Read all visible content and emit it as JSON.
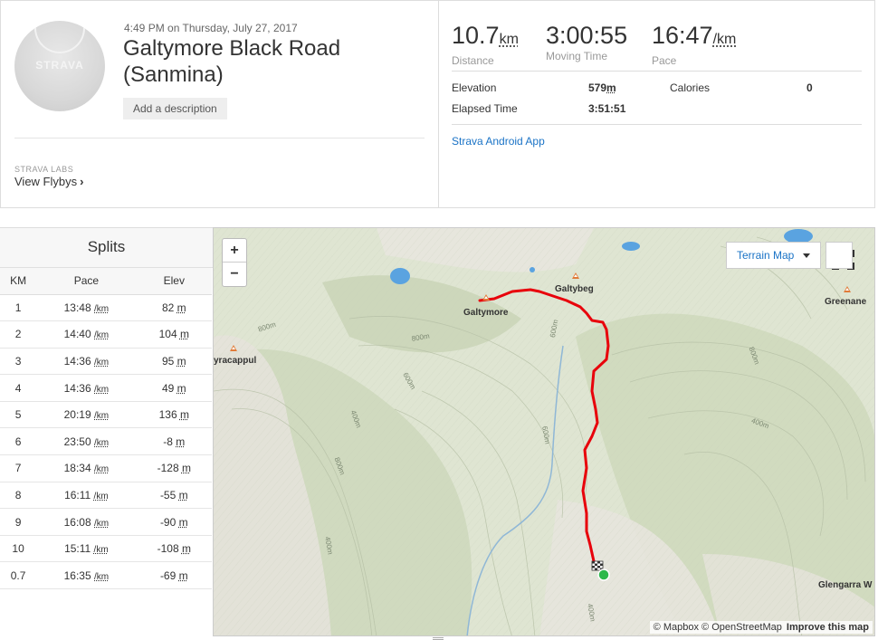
{
  "activity": {
    "datetime": "4:49 PM on Thursday, July 27, 2017",
    "title": "Galtymore Black Road (Sanmina)",
    "add_description": "Add a description",
    "avatar_logo": "STRAVA",
    "labs_tag": "STRAVA LABS",
    "flybys": "View Flybys"
  },
  "stats": {
    "distance": {
      "value": "10.7",
      "unit": "km",
      "label": "Distance"
    },
    "moving_time": {
      "value": "3:00:55",
      "label": "Moving Time"
    },
    "pace": {
      "value": "16:47",
      "unit": "/km",
      "label": "Pace"
    },
    "elevation": {
      "label": "Elevation",
      "value": "579",
      "unit": "m"
    },
    "calories": {
      "label": "Calories",
      "value": "0"
    },
    "elapsed": {
      "label": "Elapsed Time",
      "value": "3:51:51"
    },
    "device": "Strava Android App"
  },
  "splits": {
    "title": "Splits",
    "headers": [
      "KM",
      "Pace",
      "Elev"
    ],
    "rows": [
      {
        "km": "1",
        "pace": "13:48",
        "elev": "82"
      },
      {
        "km": "2",
        "pace": "14:40",
        "elev": "104"
      },
      {
        "km": "3",
        "pace": "14:36",
        "elev": "95"
      },
      {
        "km": "4",
        "pace": "14:36",
        "elev": "49"
      },
      {
        "km": "5",
        "pace": "20:19",
        "elev": "136"
      },
      {
        "km": "6",
        "pace": "23:50",
        "elev": "-8"
      },
      {
        "km": "7",
        "pace": "18:34",
        "elev": "-128"
      },
      {
        "km": "8",
        "pace": "16:11",
        "elev": "-55"
      },
      {
        "km": "9",
        "pace": "16:08",
        "elev": "-90"
      },
      {
        "km": "10",
        "pace": "15:11",
        "elev": "-108"
      },
      {
        "km": "0.7",
        "pace": "16:35",
        "elev": "-69"
      }
    ],
    "pace_unit": "/km",
    "elev_unit": "m"
  },
  "map": {
    "zoom_in": "+",
    "zoom_out": "−",
    "layer_button": "Terrain Map",
    "attribution_mapbox": "© Mapbox",
    "attribution_osm": "© OpenStreetMap",
    "improve": "Improve this map",
    "places": {
      "galtymore": "Galtymore",
      "galtybeg": "Galtybeg",
      "greenane": "Greenane",
      "yracappul": "yracappul",
      "glengarra": "Glengarra W"
    },
    "contours": [
      "800m",
      "800m",
      "600m",
      "800m",
      "400m",
      "600m",
      "400m",
      "600m",
      "800m",
      "400m",
      "400m"
    ],
    "route_color": "#e8000b"
  }
}
